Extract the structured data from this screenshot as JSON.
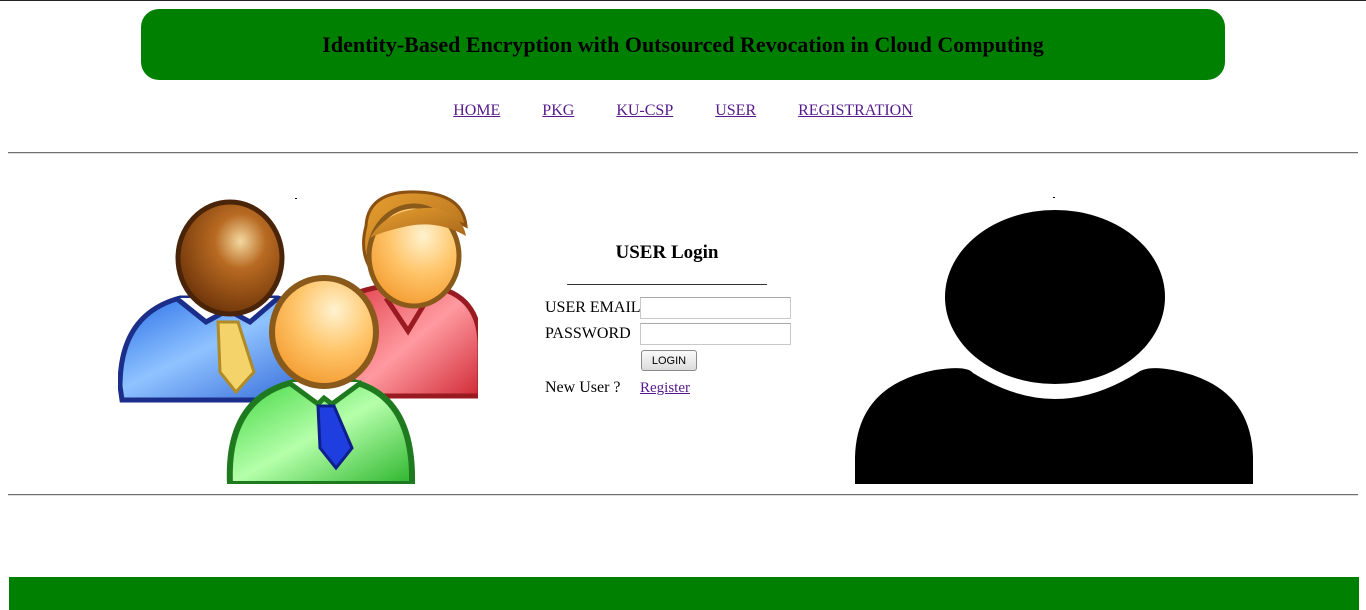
{
  "header": {
    "title": "Identity-Based Encryption with Outsourced Revocation in Cloud Computing"
  },
  "nav": {
    "items": [
      {
        "label": "HOME"
      },
      {
        "label": "PKG"
      },
      {
        "label": "KU-CSP"
      },
      {
        "label": "USER"
      },
      {
        "label": "REGISTRATION"
      }
    ]
  },
  "login": {
    "heading": "USER Login",
    "email_label": "USER EMAIL",
    "email_value": "",
    "password_label": "PASSWORD",
    "password_value": "",
    "button_label": "LOGIN",
    "new_user_text": "New User ?",
    "register_link": "Register"
  },
  "colors": {
    "banner": "#008000",
    "footer": "#008000",
    "link": "#551a8b"
  },
  "images": {
    "left": "users-group-icon",
    "right": "person-silhouette-icon"
  }
}
